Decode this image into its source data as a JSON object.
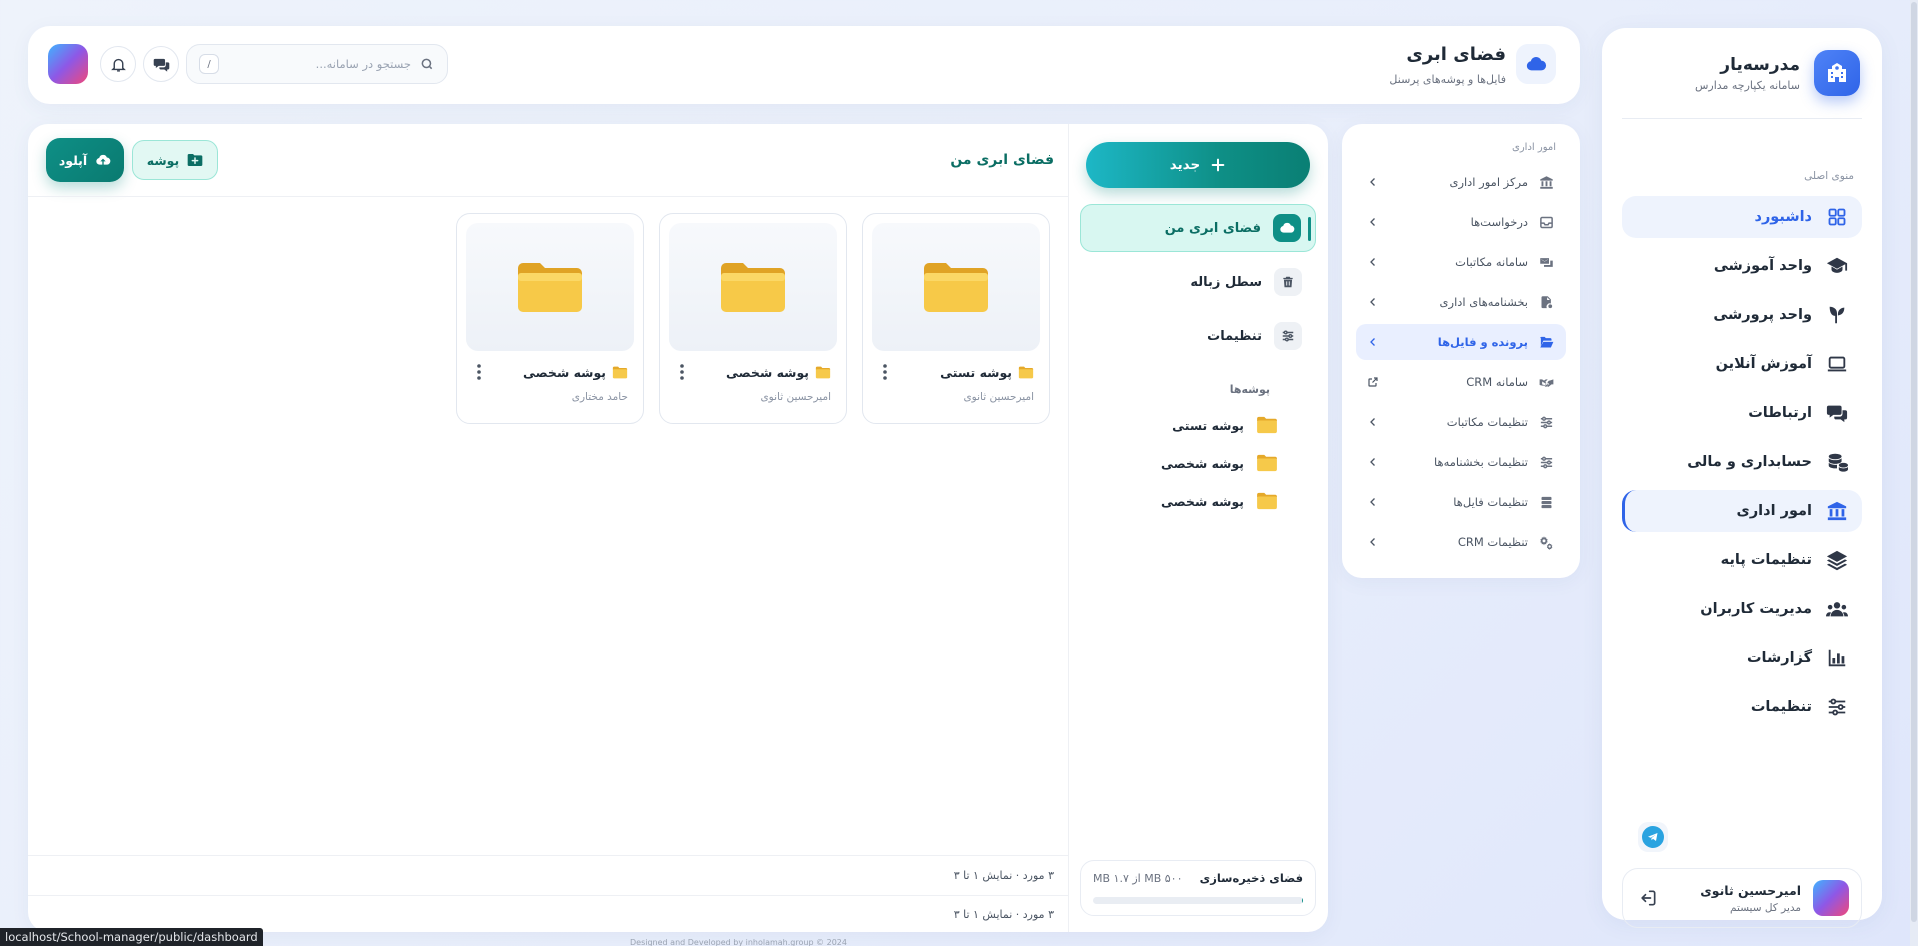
{
  "app": {
    "brand_title": "مدرسه‌یار",
    "brand_subtitle": "سامانه یکپارچه مدارس"
  },
  "colors": {
    "primary_blue": "#2f64e8",
    "teal": "#0e8f86",
    "teal_light": "#d8f7f1"
  },
  "sidebar": {
    "section_label": "منوی اصلی",
    "items": [
      {
        "label": "داشبورد",
        "icon": "grid-icon",
        "state": "active-blue"
      },
      {
        "label": "واحد آموزشی",
        "icon": "graduation-cap-icon"
      },
      {
        "label": "واحد پرورشی",
        "icon": "seedling-icon"
      },
      {
        "label": "آموزش آنلاین",
        "icon": "laptop-icon"
      },
      {
        "label": "ارتباطات",
        "icon": "chat-icon"
      },
      {
        "label": "حسابداری و مالی",
        "icon": "coins-icon"
      },
      {
        "label": "امور اداری",
        "icon": "building-icon",
        "state": "active-border"
      },
      {
        "label": "تنظیمات پایه",
        "icon": "layers-icon"
      },
      {
        "label": "مدیریت کاربران",
        "icon": "users-icon"
      },
      {
        "label": "گزارشات",
        "icon": "chart-bars-icon"
      },
      {
        "label": "تنظیمات",
        "icon": "sliders-icon"
      }
    ],
    "user": {
      "name": "امیرحسین ثانوی",
      "role": "مدیر کل سیستم"
    }
  },
  "subnav": {
    "section_label": "امور اداری",
    "items": [
      {
        "label": "مرکز امور اداری",
        "icon": "building-icon",
        "trail": "chevron"
      },
      {
        "label": "درخواست‌ها",
        "icon": "inbox-icon",
        "trail": "chevron"
      },
      {
        "label": "سامانه مکاتبات",
        "icon": "mail-stack-icon",
        "trail": "chevron"
      },
      {
        "label": "بخشنامه‌های اداری",
        "icon": "file-icon",
        "trail": "chevron"
      },
      {
        "label": "پرونده و فایل‌ها",
        "icon": "folder-open-icon",
        "trail": "chevron",
        "active": true
      },
      {
        "label": "سامانه CRM",
        "icon": "handshake-icon",
        "trail": "external"
      },
      {
        "label": "تنظیمات مکاتبات",
        "icon": "sliders-icon",
        "trail": "chevron"
      },
      {
        "label": "تنظیمات بخشنامه‌ها",
        "icon": "sliders-icon",
        "trail": "chevron"
      },
      {
        "label": "تنظیمات فایل‌ها",
        "icon": "database-icon",
        "trail": "chevron"
      },
      {
        "label": "تنظیمات CRM",
        "icon": "gears-icon",
        "trail": "chevron"
      }
    ]
  },
  "header": {
    "title": "فضای ابری",
    "subtitle": "فایل‌ها و پوشه‌های پرسنل",
    "search_placeholder": "جستجو در سامانه...",
    "search_shortcut": "/"
  },
  "drive": {
    "new_label": "جدید",
    "nav": [
      {
        "label": "فضای ابری من",
        "icon": "cloud-icon",
        "active": true
      },
      {
        "label": "سطل زباله",
        "icon": "trash-icon"
      },
      {
        "label": "تنظیمات",
        "icon": "sliders-icon"
      }
    ],
    "folders_label": "پوشه‌ها",
    "tree": [
      "پوشه تستی",
      "پوشه شخصی",
      "پوشه شخصی"
    ],
    "storage": {
      "title": "فضای ذخیره‌سازی",
      "value_text": "MB ۱.۷ از MB ۵۰۰",
      "used_fraction": 0.0034
    },
    "content_title": "فضای ابری من",
    "upload_label": "آپلود",
    "folder_label": "پوشه",
    "cards": [
      {
        "name": "پوشه تستی",
        "owner": "امیرحسین ثانوی"
      },
      {
        "name": "پوشه شخصی",
        "owner": "امیرحسین ثانوی"
      },
      {
        "name": "پوشه شخصی",
        "owner": "حامد مختاری"
      }
    ],
    "footer_text_1": "۳ مورد · نمایش ۱ تا ۳",
    "footer_text_2": "۳ مورد · نمایش ۱ تا ۳"
  },
  "credit_text": "Designed and Developed by inholamah.group © 2024",
  "status_url": "localhost/School-manager/public/dashboard"
}
